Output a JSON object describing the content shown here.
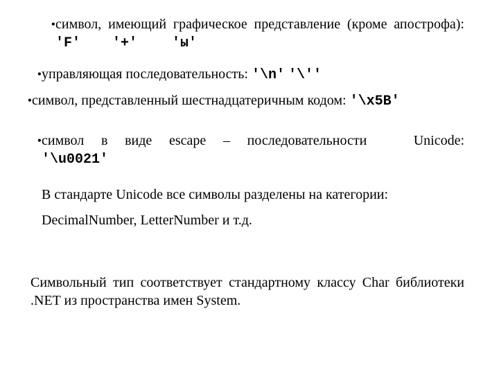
{
  "bullets": {
    "b1": {
      "pre": "символ, имеющий графическое представление (кроме апострофа): ",
      "code1": "'F'",
      "code2": "'+'",
      "code3": "'ы'"
    },
    "b2": {
      "pre": "управляющая последовательность: ",
      "code1": "'\\n'",
      "code2": "'\\''"
    },
    "b3": {
      "pre": "символ, представленный шестнадцатеричным кодом: ",
      "code1": "'\\x5B'"
    },
    "b4": {
      "part1": "символ в виде escape – последовательности",
      "part2": "Unicode:",
      "code1": "'\\u0021'"
    }
  },
  "para1": "В стандарте Unicode все символы разделены на категории:",
  "para2": "DecimalNumber, LetterNumber и т.д.",
  "para3": "Символьный тип соответствует стандартному классу Char библиотеки .NET из пространства имен System.",
  "glyphs": {
    "bullet": "•"
  }
}
